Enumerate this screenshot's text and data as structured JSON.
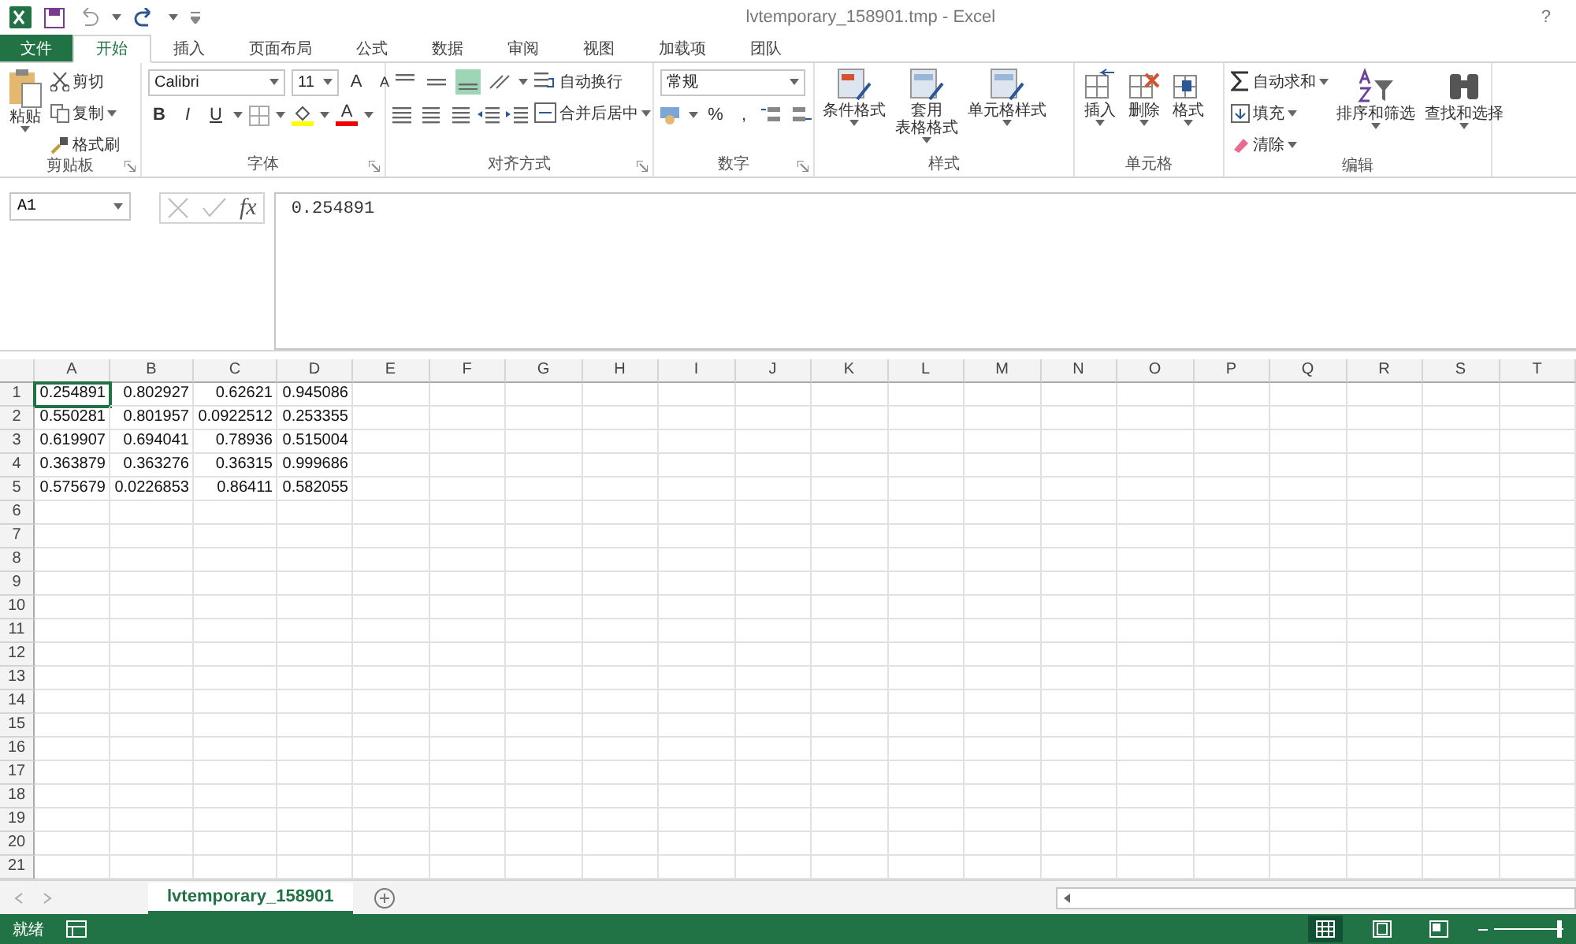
{
  "window": {
    "title": "lvtemporary_158901.tmp - Excel",
    "help": "?"
  },
  "tabs": [
    {
      "label": "文件",
      "kind": "file",
      "selected": false
    },
    {
      "label": "开始",
      "kind": "tab",
      "selected": true
    },
    {
      "label": "插入",
      "kind": "tab",
      "selected": false
    },
    {
      "label": "页面布局",
      "kind": "tab",
      "selected": false
    },
    {
      "label": "公式",
      "kind": "tab",
      "selected": false
    },
    {
      "label": "数据",
      "kind": "tab",
      "selected": false
    },
    {
      "label": "审阅",
      "kind": "tab",
      "selected": false
    },
    {
      "label": "视图",
      "kind": "tab",
      "selected": false
    },
    {
      "label": "加载项",
      "kind": "tab",
      "selected": false
    },
    {
      "label": "团队",
      "kind": "tab",
      "selected": false
    }
  ],
  "ribbon": {
    "clipboard": {
      "label": "剪贴板",
      "paste": "粘贴",
      "cut": "剪切",
      "copy": "复制",
      "painter": "格式刷"
    },
    "font": {
      "label": "字体",
      "font_name": "Calibri",
      "font_size": "11",
      "grow": "A",
      "shrink": "A",
      "bold": "B",
      "italic": "I",
      "underline": "U",
      "font_color": "A"
    },
    "alignment": {
      "label": "对齐方式",
      "vertical": [
        {
          "selected": false
        },
        {
          "selected": false
        },
        {
          "selected": true
        }
      ],
      "wrap": "自动换行",
      "merge": "合并后居中"
    },
    "number": {
      "label": "数字",
      "format": "常规",
      "percent": "%",
      "comma": ","
    },
    "styles": {
      "label": "样式",
      "items": [
        {
          "lines": [
            "条件格式"
          ]
        },
        {
          "lines": [
            "套用",
            "表格格式"
          ]
        },
        {
          "lines": [
            "单元格样式"
          ]
        }
      ]
    },
    "cells": {
      "label": "单元格",
      "items": [
        "插入",
        "删除",
        "格式"
      ]
    },
    "editing": {
      "label": "编辑",
      "autosum": "自动求和",
      "fill": "填充",
      "clear": "清除",
      "sort": "排序和筛选",
      "find": "查找和选择"
    }
  },
  "formula_bar": {
    "name_box": "A1",
    "fx": "fx",
    "value": "0.254891"
  },
  "sheet": {
    "columns": [
      "A",
      "B",
      "C",
      "D",
      "E",
      "F",
      "G",
      "H",
      "I",
      "J",
      "K",
      "L",
      "M",
      "N",
      "O",
      "P",
      "Q",
      "R",
      "S",
      "T"
    ],
    "rows": [
      {
        "number": "1",
        "cells": [
          "0.254891",
          "0.802927",
          "0.62621",
          "0.945086"
        ]
      },
      {
        "number": "2",
        "cells": [
          "0.550281",
          "0.801957",
          "0.0922512",
          "0.253355"
        ]
      },
      {
        "number": "3",
        "cells": [
          "0.619907",
          "0.694041",
          "0.78936",
          "0.515004"
        ]
      },
      {
        "number": "4",
        "cells": [
          "0.363879",
          "0.363276",
          "0.36315",
          "0.999686"
        ]
      },
      {
        "number": "5",
        "cells": [
          "0.575679",
          "0.0226853",
          "0.86411",
          "0.582055"
        ]
      },
      {
        "number": "6",
        "cells": []
      },
      {
        "number": "7",
        "cells": []
      },
      {
        "number": "8",
        "cells": []
      },
      {
        "number": "9",
        "cells": []
      },
      {
        "number": "10",
        "cells": []
      },
      {
        "number": "11",
        "cells": []
      },
      {
        "number": "12",
        "cells": []
      },
      {
        "number": "13",
        "cells": []
      },
      {
        "number": "14",
        "cells": []
      },
      {
        "number": "15",
        "cells": []
      },
      {
        "number": "16",
        "cells": []
      },
      {
        "number": "17",
        "cells": []
      },
      {
        "number": "18",
        "cells": []
      },
      {
        "number": "19",
        "cells": []
      },
      {
        "number": "20",
        "cells": []
      },
      {
        "number": "21",
        "cells": []
      }
    ]
  },
  "sheet_tabs": [
    {
      "label": "lvtemporary_158901",
      "selected": true
    }
  ],
  "status_bar": {
    "status": "就绪",
    "views": [
      {
        "selected": true
      },
      {
        "selected": false
      },
      {
        "selected": false
      }
    ],
    "zoom_slider": {
      "level": 0.9
    }
  }
}
